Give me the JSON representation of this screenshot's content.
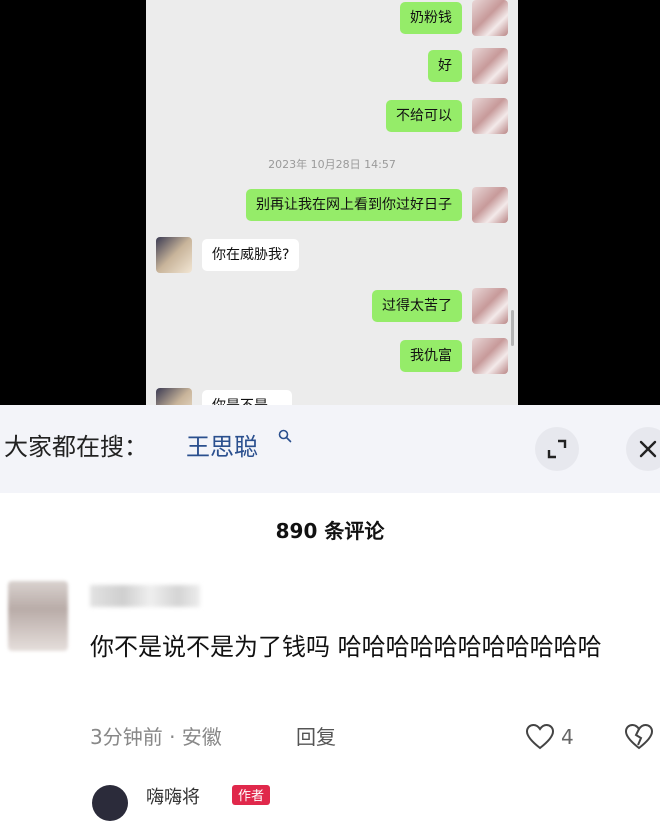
{
  "chat": {
    "messages_me_top": [
      "奶粉钱",
      "好",
      "不给可以"
    ],
    "timestamp": "2023年 10月28日 14:57",
    "msg_threat": "别再让我在网上看到你过好日子",
    "msg_reply_other": "你在威胁我?",
    "msg_hard": "过得太苦了",
    "msg_rich": "我仇富",
    "msg_cut": "你是不是…"
  },
  "search": {
    "label": "大家都在搜：",
    "term": "王思聪",
    "icons": [
      "search-icon",
      "expand-icon",
      "close-icon"
    ]
  },
  "comments": {
    "count_label": "890 条评论",
    "first": {
      "text": "你不是说不是为了钱吗 哈哈哈哈哈哈哈哈哈哈哈",
      "meta": "3分钟前 · 安徽",
      "reply_label": "回复",
      "likes": "4"
    },
    "next": {
      "name": "嗨嗨将",
      "badge": "作者"
    }
  },
  "colors": {
    "bubble_green": "#95ec69",
    "search_term": "#2a4f8e",
    "badge_red": "#e0284b"
  }
}
